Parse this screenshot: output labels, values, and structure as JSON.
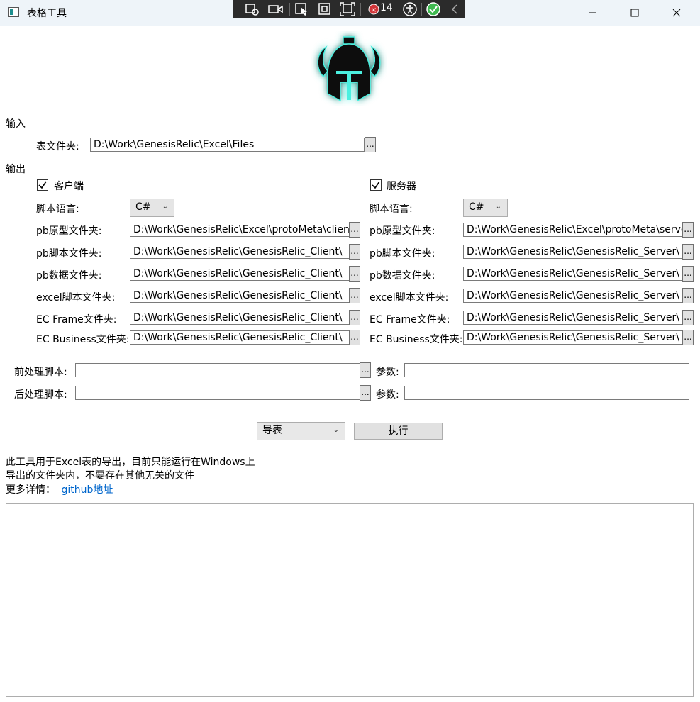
{
  "window": {
    "title": "表格工具"
  },
  "debug_toolbar": {
    "count": "14"
  },
  "input": {
    "section_label": "输入",
    "table_folder_label": "表文件夹:",
    "table_folder_value": "D:\\Work\\GenesisRelic\\Excel\\Files",
    "browse_label": "..."
  },
  "output": {
    "section_label": "输出",
    "client": {
      "checkbox_label": "客户端",
      "script_lang_label": "脚本语言:",
      "script_lang_value": "C#",
      "fields": [
        {
          "label": "pb原型文件夹:",
          "value": "D:\\Work\\GenesisRelic\\Excel\\protoMeta\\client"
        },
        {
          "label": "pb脚本文件夹:",
          "value": "D:\\Work\\GenesisRelic\\GenesisRelic_Client\\"
        },
        {
          "label": "pb数据文件夹:",
          "value": "D:\\Work\\GenesisRelic\\GenesisRelic_Client\\"
        },
        {
          "label": "excel脚本文件夹:",
          "value": "D:\\Work\\GenesisRelic\\GenesisRelic_Client\\"
        },
        {
          "label": "EC Frame文件夹:",
          "value": "D:\\Work\\GenesisRelic\\GenesisRelic_Client\\"
        },
        {
          "label": "EC Business文件夹:",
          "value": "D:\\Work\\GenesisRelic\\GenesisRelic_Client\\"
        }
      ]
    },
    "server": {
      "checkbox_label": "服务器",
      "script_lang_label": "脚本语言:",
      "script_lang_value": "C#",
      "fields": [
        {
          "label": "pb原型文件夹:",
          "value": "D:\\Work\\GenesisRelic\\Excel\\protoMeta\\server"
        },
        {
          "label": "pb脚本文件夹:",
          "value": "D:\\Work\\GenesisRelic\\GenesisRelic_Server\\"
        },
        {
          "label": "pb数据文件夹:",
          "value": "D:\\Work\\GenesisRelic\\GenesisRelic_Server\\"
        },
        {
          "label": "excel脚本文件夹:",
          "value": "D:\\Work\\GenesisRelic\\GenesisRelic_Server\\"
        },
        {
          "label": "EC Frame文件夹:",
          "value": "D:\\Work\\GenesisRelic\\GenesisRelic_Server\\"
        },
        {
          "label": "EC Business文件夹:",
          "value": "D:\\Work\\GenesisRelic\\GenesisRelic_Server\\"
        }
      ]
    }
  },
  "scripts": {
    "pre_label": "前处理脚本:",
    "post_label": "后处理脚本:",
    "param_label": "参数:",
    "pre_value": "",
    "post_value": "",
    "pre_param": "",
    "post_param": ""
  },
  "actions": {
    "mode_value": "导表",
    "execute_label": "执行"
  },
  "info": {
    "line1": "此工具用于Excel表的导出，目前只能运行在Windows上",
    "line2": "导出的文件夹内，不要存在其他无关的文件",
    "more_label": "更多详情：",
    "link_text": "github地址"
  },
  "log": {
    "text": ""
  }
}
